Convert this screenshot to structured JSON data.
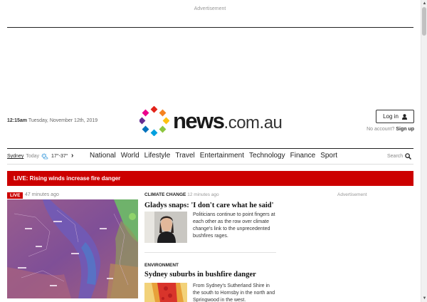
{
  "ad_top_label": "Advertisement",
  "ad_right_label": "Advertisement",
  "timestamp": {
    "time": "12:15am",
    "date": "Tuesday, November 12th, 2019"
  },
  "logo": {
    "name": "news",
    "suffix": ".com.au"
  },
  "account": {
    "login_label": "Log in",
    "no_account": "No account?",
    "signup": "Sign up"
  },
  "weather": {
    "city": "Sydney",
    "day": "Today",
    "temps": "17°-37°",
    "icon": "partly-sunny-icon"
  },
  "nav": {
    "chevron": "›",
    "items": [
      "National",
      "World",
      "Lifestyle",
      "Travel",
      "Entertainment",
      "Technology",
      "Finance",
      "Sport"
    ],
    "search_label": "Search"
  },
  "live_banner": "LIVE: Rising winds increase fire danger",
  "lead_story": {
    "tag": "LIVE",
    "time_ago": "47 minutes ago"
  },
  "stories": [
    {
      "category": "CLIMATE CHANGE",
      "time_ago": "12 minutes ago",
      "headline": "Gladys snaps: 'I don't care what he said'",
      "blurb": "Politicians continue to point fingers at each other as the row over climate change's link to the unprecedented bushfires rages."
    },
    {
      "category": "ENVIRONMENT",
      "time_ago": "",
      "headline": "Sydney suburbs in bushfire danger",
      "blurb": "From Sydney's Sutherland Shire in the south to Hornsby in the north and Springwood in the west."
    }
  ],
  "colors": {
    "brand_red": "#cc0000",
    "text": "#222222"
  }
}
